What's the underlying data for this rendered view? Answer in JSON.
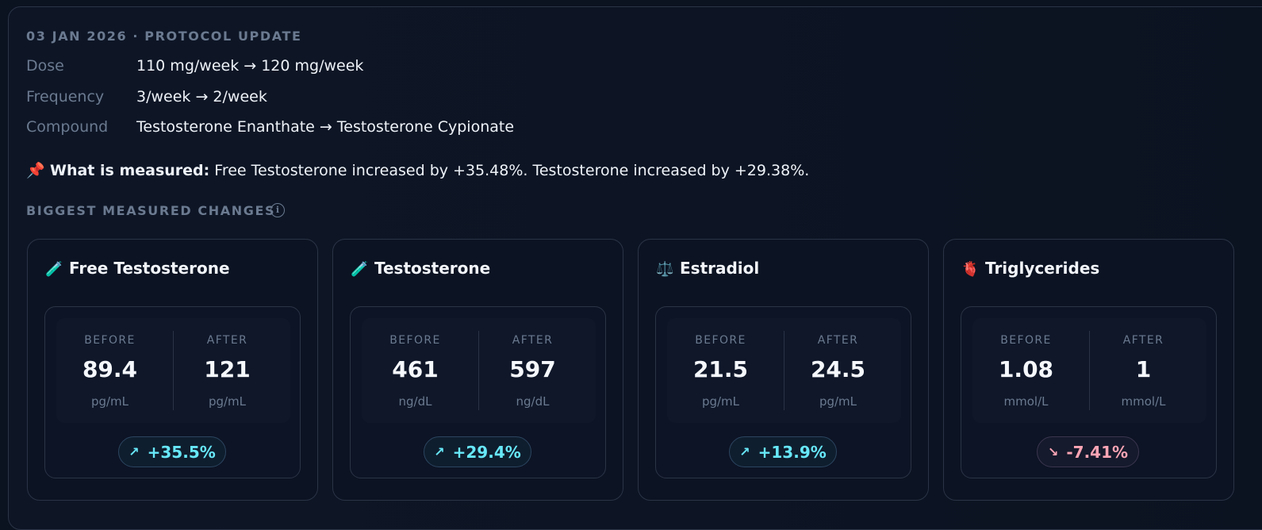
{
  "header": "03 JAN 2026 · PROTOCOL UPDATE",
  "changes": [
    {
      "key": "Dose",
      "value": "110 mg/week → 120 mg/week"
    },
    {
      "key": "Frequency",
      "value": "3/week → 2/week"
    },
    {
      "key": "Compound",
      "value": "Testosterone Enanthate → Testosterone Cypionate"
    }
  ],
  "measured": {
    "icon": "pushpin-icon",
    "label": "What is measured:",
    "text": " Free Testosterone increased by +35.48%. Testosterone increased by +29.38%."
  },
  "section_title": "BIGGEST MEASURED CHANGES",
  "info_icon": "i",
  "before_label": "BEFORE",
  "after_label": "AFTER",
  "cards": [
    {
      "emoji": "🧪",
      "icon": "test-tube-icon",
      "title": "Free Testosterone",
      "before": "89.4",
      "after": "121",
      "before_unit": "pg/mL",
      "after_unit": "pg/mL",
      "arrow": "↗",
      "change": "+35.5%",
      "direction": "up"
    },
    {
      "emoji": "🧪",
      "icon": "test-tube-icon",
      "title": "Testosterone",
      "before": "461",
      "after": "597",
      "before_unit": "ng/dL",
      "after_unit": "ng/dL",
      "arrow": "↗",
      "change": "+29.4%",
      "direction": "up"
    },
    {
      "emoji": "⚖️",
      "icon": "scales-icon",
      "title": "Estradiol",
      "before": "21.5",
      "after": "24.5",
      "before_unit": "pg/mL",
      "after_unit": "pg/mL",
      "arrow": "↗",
      "change": "+13.9%",
      "direction": "up"
    },
    {
      "emoji": "🫀",
      "icon": "heart-icon",
      "title": "Triglycerides",
      "before": "1.08",
      "after": "1",
      "before_unit": "mmol/L",
      "after_unit": "mmol/L",
      "arrow": "↘",
      "change": "-7.41%",
      "direction": "down"
    }
  ],
  "colors": {
    "up": "#67e8f9",
    "down": "#fca5b5",
    "muted": "#6b7a90"
  }
}
